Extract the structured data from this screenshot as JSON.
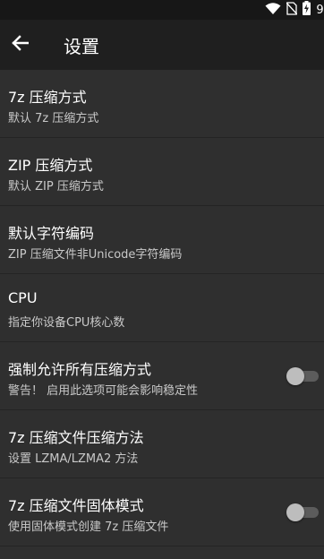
{
  "status_bar": {
    "time": "9:",
    "icons": [
      "wifi-icon",
      "no-sim-icon",
      "battery-charging-icon"
    ]
  },
  "toolbar": {
    "back_icon": "arrow-left-icon",
    "title": "设置"
  },
  "settings": [
    {
      "title": "7z 压缩方式",
      "subtitle": "默认 7z 压缩方式",
      "has_toggle": false
    },
    {
      "title": "ZIP 压缩方式",
      "subtitle": "默认 ZIP 压缩方式",
      "has_toggle": false
    },
    {
      "title": "默认字符编码",
      "subtitle": "ZIP 压缩文件非Unicode字符编码",
      "has_toggle": false
    },
    {
      "title": "CPU",
      "subtitle": "指定你设备CPU核心数",
      "has_toggle": false
    },
    {
      "title": "强制允许所有压缩方式",
      "subtitle": "警告！ 启用此选项可能会影响稳定性",
      "has_toggle": true,
      "toggle_on": false
    },
    {
      "title": "7z 压缩文件压缩方法",
      "subtitle": "设置 LZMA/LZMA2 方法",
      "has_toggle": false
    },
    {
      "title": "7z 压缩文件固体模式",
      "subtitle": "使用固体模式创建 7z 压缩文件",
      "has_toggle": true,
      "toggle_on": false
    }
  ],
  "colors": {
    "background": "#2f2f2f",
    "toolbar": "#1f1f1f",
    "status_bar": "#171717",
    "divider": "#242424"
  }
}
